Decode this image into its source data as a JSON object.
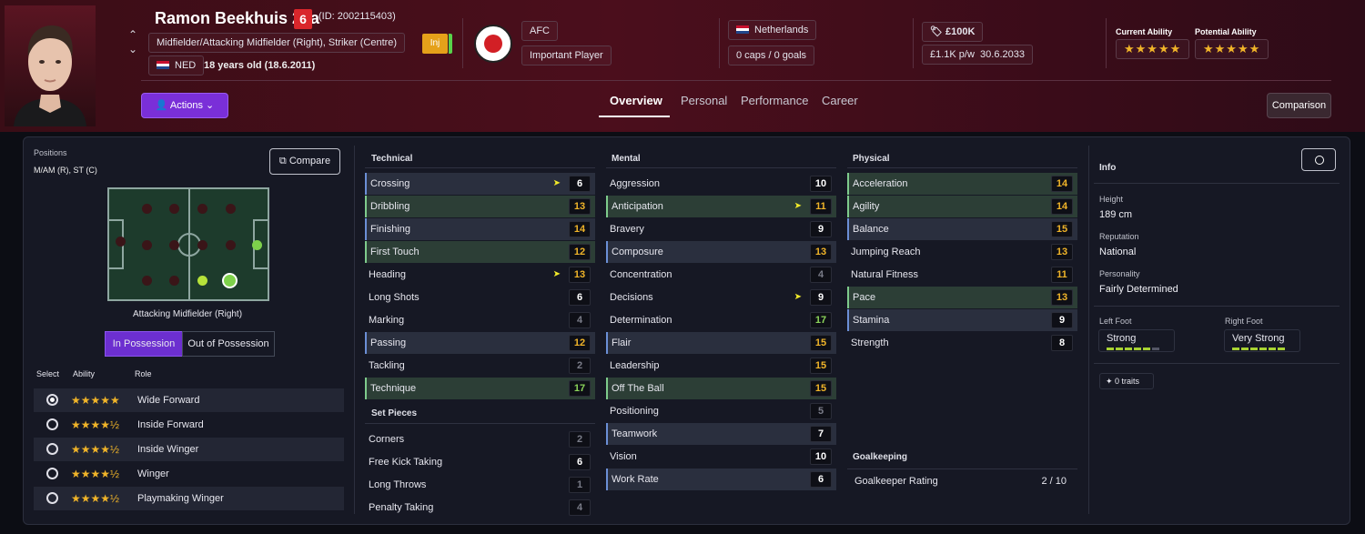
{
  "header": {
    "name": "Ramon Beekhuis 27a",
    "number": "6",
    "id": "(ID: 2002115403)",
    "positions": "Midfielder/Attacking Midfielder (Right), Striker (Centre)",
    "nationality_code": "NED",
    "age": "18 years old (18.6.2011)",
    "injury": "Inj",
    "club": "AFC",
    "club_status": "Important Player",
    "country": "Netherlands",
    "caps": "0 caps / 0 goals",
    "value": "£100K",
    "wage": "£1.1K p/w",
    "contract": "30.6.2033",
    "current_ability_label": "Current Ability",
    "potential_ability_label": "Potential Ability",
    "current_ability_stars": "★★★★★",
    "potential_ability_stars": "★★★★★",
    "actions_label": "Actions",
    "comparison_label": "Comparison",
    "tabs": [
      "Overview",
      "Personal",
      "Performance",
      "Career"
    ],
    "active_tab": "Overview"
  },
  "left": {
    "positions_label": "Positions",
    "positions_value": "M/AM (R), ST (C)",
    "compare_label": "Compare",
    "pitch_caption": "Attacking Midfielder (Right)",
    "possession_tabs": [
      "In Possession",
      "Out of Possession"
    ],
    "roles_headers": {
      "select": "Select",
      "ability": "Ability",
      "role": "Role"
    },
    "roles": [
      {
        "name": "Wide Forward",
        "stars": "★★★★★",
        "selected": true
      },
      {
        "name": "Inside Forward",
        "stars": "★★★★½",
        "selected": false
      },
      {
        "name": "Inside Winger",
        "stars": "★★★★½",
        "selected": false
      },
      {
        "name": "Winger",
        "stars": "★★★★½",
        "selected": false
      },
      {
        "name": "Playmaking Winger",
        "stars": "★★★★½",
        "selected": false
      }
    ]
  },
  "attributes": {
    "technical_label": "Technical",
    "mental_label": "Mental",
    "physical_label": "Physical",
    "set_pieces_label": "Set Pieces",
    "goalkeeping_label": "Goalkeeping",
    "technical": [
      {
        "name": "Crossing",
        "value": "6",
        "color": "w",
        "trend": true,
        "bg": "bg",
        "border": "bb"
      },
      {
        "name": "Dribbling",
        "value": "13",
        "color": "o",
        "trend": false,
        "bg": "gr",
        "border": "gb"
      },
      {
        "name": "Finishing",
        "value": "14",
        "color": "o",
        "trend": false,
        "bg": "bg",
        "border": "bb"
      },
      {
        "name": "First Touch",
        "value": "12",
        "color": "o",
        "trend": false,
        "bg": "gr",
        "border": "gb"
      },
      {
        "name": "Heading",
        "value": "13",
        "color": "o",
        "trend": true,
        "bg": "",
        "border": ""
      },
      {
        "name": "Long Shots",
        "value": "6",
        "color": "w",
        "trend": false,
        "bg": "",
        "border": ""
      },
      {
        "name": "Marking",
        "value": "4",
        "color": "d",
        "trend": false,
        "bg": "",
        "border": ""
      },
      {
        "name": "Passing",
        "value": "12",
        "color": "o",
        "trend": false,
        "bg": "bg",
        "border": "bb"
      },
      {
        "name": "Tackling",
        "value": "2",
        "color": "d",
        "trend": false,
        "bg": "",
        "border": ""
      },
      {
        "name": "Technique",
        "value": "17",
        "color": "g",
        "trend": false,
        "bg": "gr",
        "border": "gb"
      }
    ],
    "set_pieces": [
      {
        "name": "Corners",
        "value": "2",
        "color": "d"
      },
      {
        "name": "Free Kick Taking",
        "value": "6",
        "color": "w"
      },
      {
        "name": "Long Throws",
        "value": "1",
        "color": "d"
      },
      {
        "name": "Penalty Taking",
        "value": "4",
        "color": "d"
      }
    ],
    "mental": [
      {
        "name": "Aggression",
        "value": "10",
        "color": "w",
        "trend": false,
        "bg": "",
        "border": ""
      },
      {
        "name": "Anticipation",
        "value": "11",
        "color": "o",
        "trend": true,
        "bg": "gr",
        "border": "gb"
      },
      {
        "name": "Bravery",
        "value": "9",
        "color": "w",
        "trend": false,
        "bg": "",
        "border": ""
      },
      {
        "name": "Composure",
        "value": "13",
        "color": "o",
        "trend": false,
        "bg": "bg",
        "border": "bb"
      },
      {
        "name": "Concentration",
        "value": "4",
        "color": "d",
        "trend": false,
        "bg": "",
        "border": ""
      },
      {
        "name": "Decisions",
        "value": "9",
        "color": "w",
        "trend": true,
        "bg": "",
        "border": ""
      },
      {
        "name": "Determination",
        "value": "17",
        "color": "g",
        "trend": false,
        "bg": "",
        "border": ""
      },
      {
        "name": "Flair",
        "value": "15",
        "color": "o",
        "trend": false,
        "bg": "bg",
        "border": "bb"
      },
      {
        "name": "Leadership",
        "value": "15",
        "color": "o",
        "trend": false,
        "bg": "",
        "border": ""
      },
      {
        "name": "Off The Ball",
        "value": "15",
        "color": "o",
        "trend": false,
        "bg": "gr",
        "border": "gb"
      },
      {
        "name": "Positioning",
        "value": "5",
        "color": "d",
        "trend": false,
        "bg": "",
        "border": ""
      },
      {
        "name": "Teamwork",
        "value": "7",
        "color": "w",
        "trend": false,
        "bg": "bg",
        "border": "bb"
      },
      {
        "name": "Vision",
        "value": "10",
        "color": "w",
        "trend": false,
        "bg": "",
        "border": ""
      },
      {
        "name": "Work Rate",
        "value": "6",
        "color": "w",
        "trend": false,
        "bg": "bg",
        "border": "bb"
      }
    ],
    "physical": [
      {
        "name": "Acceleration",
        "value": "14",
        "color": "o",
        "trend": false,
        "bg": "gr",
        "border": "gb"
      },
      {
        "name": "Agility",
        "value": "14",
        "color": "o",
        "trend": false,
        "bg": "gr",
        "border": "gb"
      },
      {
        "name": "Balance",
        "value": "15",
        "color": "o",
        "trend": false,
        "bg": "bg",
        "border": "bb"
      },
      {
        "name": "Jumping Reach",
        "value": "13",
        "color": "o",
        "trend": false,
        "bg": "",
        "border": ""
      },
      {
        "name": "Natural Fitness",
        "value": "11",
        "color": "o",
        "trend": false,
        "bg": "",
        "border": ""
      },
      {
        "name": "Pace",
        "value": "13",
        "color": "o",
        "trend": false,
        "bg": "gr",
        "border": "gb"
      },
      {
        "name": "Stamina",
        "value": "9",
        "color": "w",
        "trend": false,
        "bg": "bg",
        "border": "bb"
      },
      {
        "name": "Strength",
        "value": "8",
        "color": "w",
        "trend": false,
        "bg": "",
        "border": ""
      }
    ],
    "goalkeeper_rating_label": "Goalkeeper Rating",
    "goalkeeper_rating_value": "2 / 10"
  },
  "info": {
    "title": "Info",
    "height_label": "Height",
    "height_value": "189 cm",
    "reputation_label": "Reputation",
    "reputation_value": "National",
    "personality_label": "Personality",
    "personality_value": "Fairly Determined",
    "left_foot_label": "Left Foot",
    "left_foot_value": "Strong",
    "right_foot_label": "Right Foot",
    "right_foot_value": "Very Strong",
    "traits_label": "0 traits"
  }
}
